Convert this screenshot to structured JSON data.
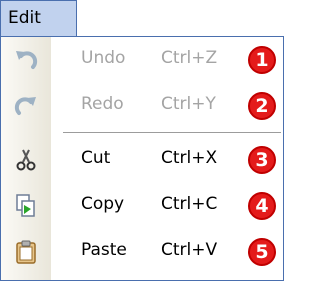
{
  "menu": {
    "title": "Edit",
    "items": [
      {
        "label": "Undo",
        "shortcut": "Ctrl+Z",
        "badge": "1",
        "icon": "undo-icon",
        "enabled": false
      },
      {
        "label": "Redo",
        "shortcut": "Ctrl+Y",
        "badge": "2",
        "icon": "redo-icon",
        "enabled": false
      },
      {
        "label": "Cut",
        "shortcut": "Ctrl+X",
        "badge": "3",
        "icon": "cut-icon",
        "enabled": true
      },
      {
        "label": "Copy",
        "shortcut": "Ctrl+C",
        "badge": "4",
        "icon": "copy-icon",
        "enabled": true
      },
      {
        "label": "Paste",
        "shortcut": "Ctrl+V",
        "badge": "5",
        "icon": "paste-icon",
        "enabled": true
      }
    ]
  },
  "colors": {
    "menu_highlight": "#c1d2ee",
    "border": "#4a6fae",
    "disabled_text": "#a4a4a4",
    "badge": "#e41b1b"
  }
}
